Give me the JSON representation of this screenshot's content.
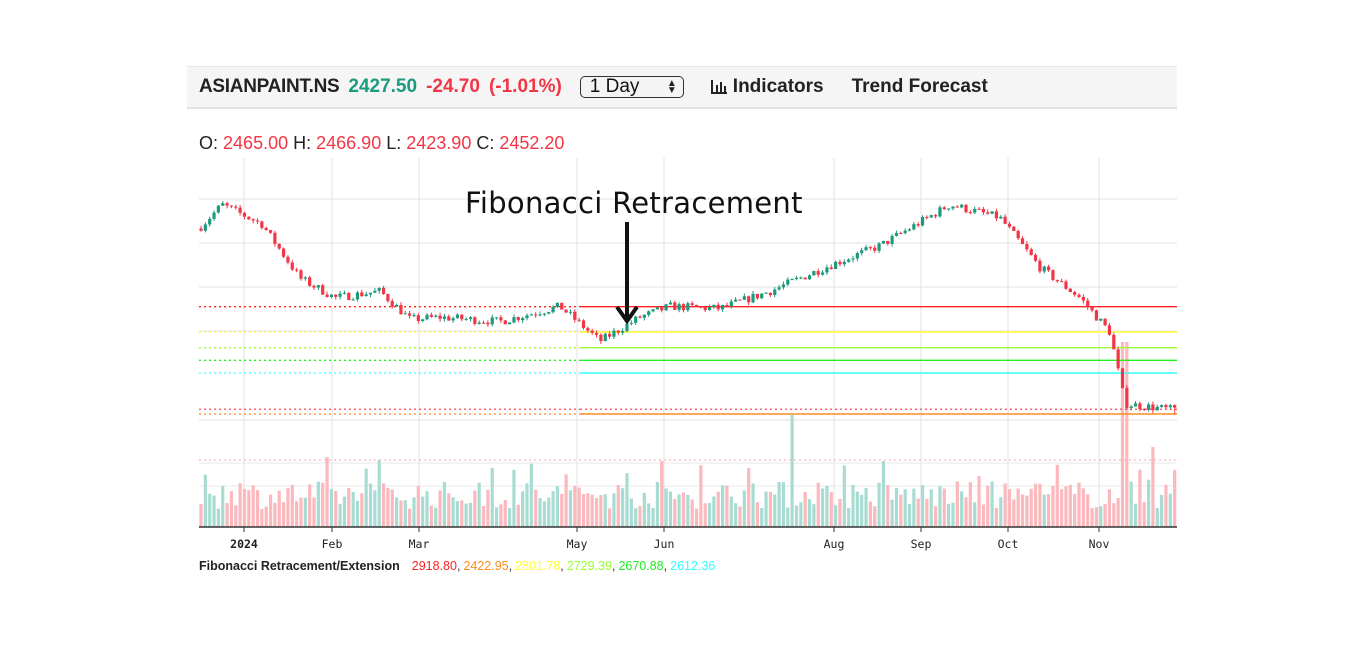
{
  "toolbar": {
    "symbol": "ASIANPAINT.NS",
    "last_price": "2427.50",
    "change": "-24.70",
    "change_pct": "(-1.01%)",
    "interval_select": {
      "selected": "1 Day"
    },
    "indicators_label": "Indicators",
    "indicators_icon": "bar-chart-icon",
    "trend_forecast_label": "Trend Forecast"
  },
  "ohlc": {
    "o_label": "O:",
    "o": "2465.00",
    "h_label": "H:",
    "h": "2466.90",
    "l_label": "L:",
    "l": "2423.90",
    "c_label": "C:",
    "c": "2452.20"
  },
  "annotation": {
    "text": "Fibonacci Retracement",
    "arrow": "arrow-down-icon"
  },
  "legend": {
    "label": "Fibonacci Retracement/Extension",
    "values": [
      "2918.80",
      "2422.95",
      "2801.78",
      "2729.39",
      "2670.88",
      "2612.36"
    ],
    "colors": [
      "#ff2020",
      "#ff8c1a",
      "#ffff33",
      "#99ff33",
      "#22ee22",
      "#33ffff"
    ]
  },
  "colors": {
    "up": "#1a9b7e",
    "down": "#f23645",
    "up_volume": "#a8dcd2",
    "down_volume": "#fbb8bd"
  },
  "chart_data": {
    "type": "candlestick",
    "title": "ASIANPAINT.NS",
    "x_tick_labels": [
      "2024",
      "Feb",
      "Mar",
      "May",
      "Jun",
      "Aug",
      "Sep",
      "Oct",
      "Nov"
    ],
    "grid": true,
    "legend_position": "bottom-left",
    "fibonacci_levels": [
      {
        "value": 2918.8,
        "color": "#ff2020",
        "style": "dotted-then-solid"
      },
      {
        "value": 2801.78,
        "color": "#ffff33",
        "style": "dotted-then-solid"
      },
      {
        "value": 2729.39,
        "color": "#99ff33",
        "style": "dotted-then-solid"
      },
      {
        "value": 2670.88,
        "color": "#22ee22",
        "style": "dotted-then-solid"
      },
      {
        "value": 2612.36,
        "color": "#33ffff",
        "style": "dotted-then-solid"
      },
      {
        "value": 2422.95,
        "color": "#ff8c1a",
        "style": "dotted-then-solid"
      },
      {
        "value": 2445.0,
        "color": "#ff4050",
        "style": "dotted"
      }
    ],
    "price_path_anchors": [
      {
        "month": "Jan-early",
        "price": 3280
      },
      {
        "month": "Jan-mid",
        "price": 3390
      },
      {
        "month": "Jan-late",
        "price": 3300
      },
      {
        "month": "Feb-early",
        "price": 3050
      },
      {
        "month": "Feb-mid",
        "price": 2960
      },
      {
        "month": "Feb-late",
        "price": 2990
      },
      {
        "month": "Mar-early",
        "price": 2860
      },
      {
        "month": "Mar-mid",
        "price": 2870
      },
      {
        "month": "Apr",
        "price": 2850
      },
      {
        "month": "Apr-late",
        "price": 2920
      },
      {
        "month": "May-early",
        "price": 2760
      },
      {
        "month": "May-late",
        "price": 2870
      },
      {
        "month": "Jun",
        "price": 2920
      },
      {
        "month": "Jul",
        "price": 2910
      },
      {
        "month": "Jul-late",
        "price": 2990
      },
      {
        "month": "Aug-early",
        "price": 3110
      },
      {
        "month": "Aug-late",
        "price": 3200
      },
      {
        "month": "Sep-mid",
        "price": 3390
      },
      {
        "month": "Sep-late",
        "price": 3330
      },
      {
        "month": "Oct-early",
        "price": 3100
      },
      {
        "month": "Oct-late",
        "price": 2960
      },
      {
        "month": "Nov-early",
        "price": 2800
      },
      {
        "month": "Nov-mid",
        "price": 2470
      },
      {
        "month": "Nov-late",
        "price": 2440
      }
    ],
    "last_candle": {
      "open": 2465.0,
      "high": 2466.9,
      "low": 2423.9,
      "close": 2452.2
    }
  }
}
